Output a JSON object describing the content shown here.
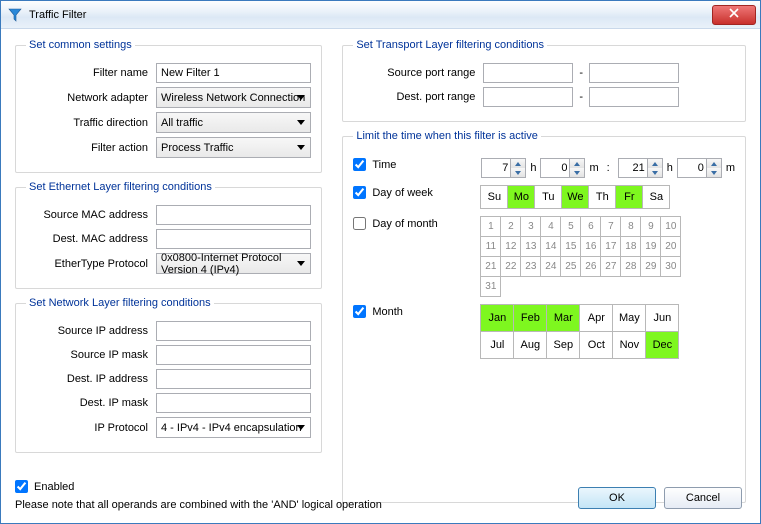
{
  "window": {
    "title": "Traffic Filter"
  },
  "common": {
    "legend": "Set common settings",
    "filter_name_lbl": "Filter name",
    "filter_name": "New Filter 1",
    "adapter_lbl": "Network adapter",
    "adapter": "Wireless Network Connection",
    "direction_lbl": "Traffic direction",
    "direction": "All traffic",
    "action_lbl": "Filter action",
    "action": "Process Traffic"
  },
  "eth": {
    "legend": "Set Ethernet Layer filtering conditions",
    "src_mac_lbl": "Source MAC address",
    "src_mac": "",
    "dst_mac_lbl": "Dest. MAC address",
    "dst_mac": "",
    "proto_lbl": "EtherType Protocol",
    "proto": "0x0800-Internet Protocol Version 4 (IPv4)"
  },
  "net": {
    "legend": "Set Network Layer filtering conditions",
    "src_ip_lbl": "Source IP address",
    "src_ip": "",
    "src_mask_lbl": "Source IP mask",
    "src_mask": "",
    "dst_ip_lbl": "Dest. IP address",
    "dst_ip": "",
    "dst_mask_lbl": "Dest. IP mask",
    "dst_mask": "",
    "proto_lbl": "IP Protocol",
    "proto": "4 - IPv4 - IPv4 encapsulation"
  },
  "transport": {
    "legend": "Set Transport Layer filtering conditions",
    "src_lbl": "Source port range",
    "src_from": "",
    "src_to": "",
    "dst_lbl": "Dest. port range",
    "dst_from": "",
    "dst_to": ""
  },
  "time": {
    "legend": "Limit the time when this filter is active",
    "time_lbl": "Time",
    "h1": "7",
    "m1": "0",
    "h2": "21",
    "m2": "0",
    "h": "h",
    "m": "m",
    "colon": ":",
    "dow_lbl": "Day of week",
    "dow": [
      "Su",
      "Mo",
      "Tu",
      "We",
      "Th",
      "Fr",
      "Sa"
    ],
    "dow_sel": [
      false,
      true,
      false,
      true,
      false,
      true,
      false
    ],
    "dom_lbl": "Day of month",
    "month_lbl": "Month",
    "months": [
      "Jan",
      "Feb",
      "Mar",
      "Apr",
      "May",
      "Jun",
      "Jul",
      "Aug",
      "Sep",
      "Oct",
      "Nov",
      "Dec"
    ],
    "months_sel": [
      true,
      true,
      true,
      false,
      false,
      false,
      false,
      false,
      false,
      false,
      false,
      true
    ]
  },
  "footer": {
    "enabled_lbl": "Enabled",
    "note": "Please note that all operands are combined with the 'AND' logical operation",
    "ok": "OK",
    "cancel": "Cancel"
  }
}
